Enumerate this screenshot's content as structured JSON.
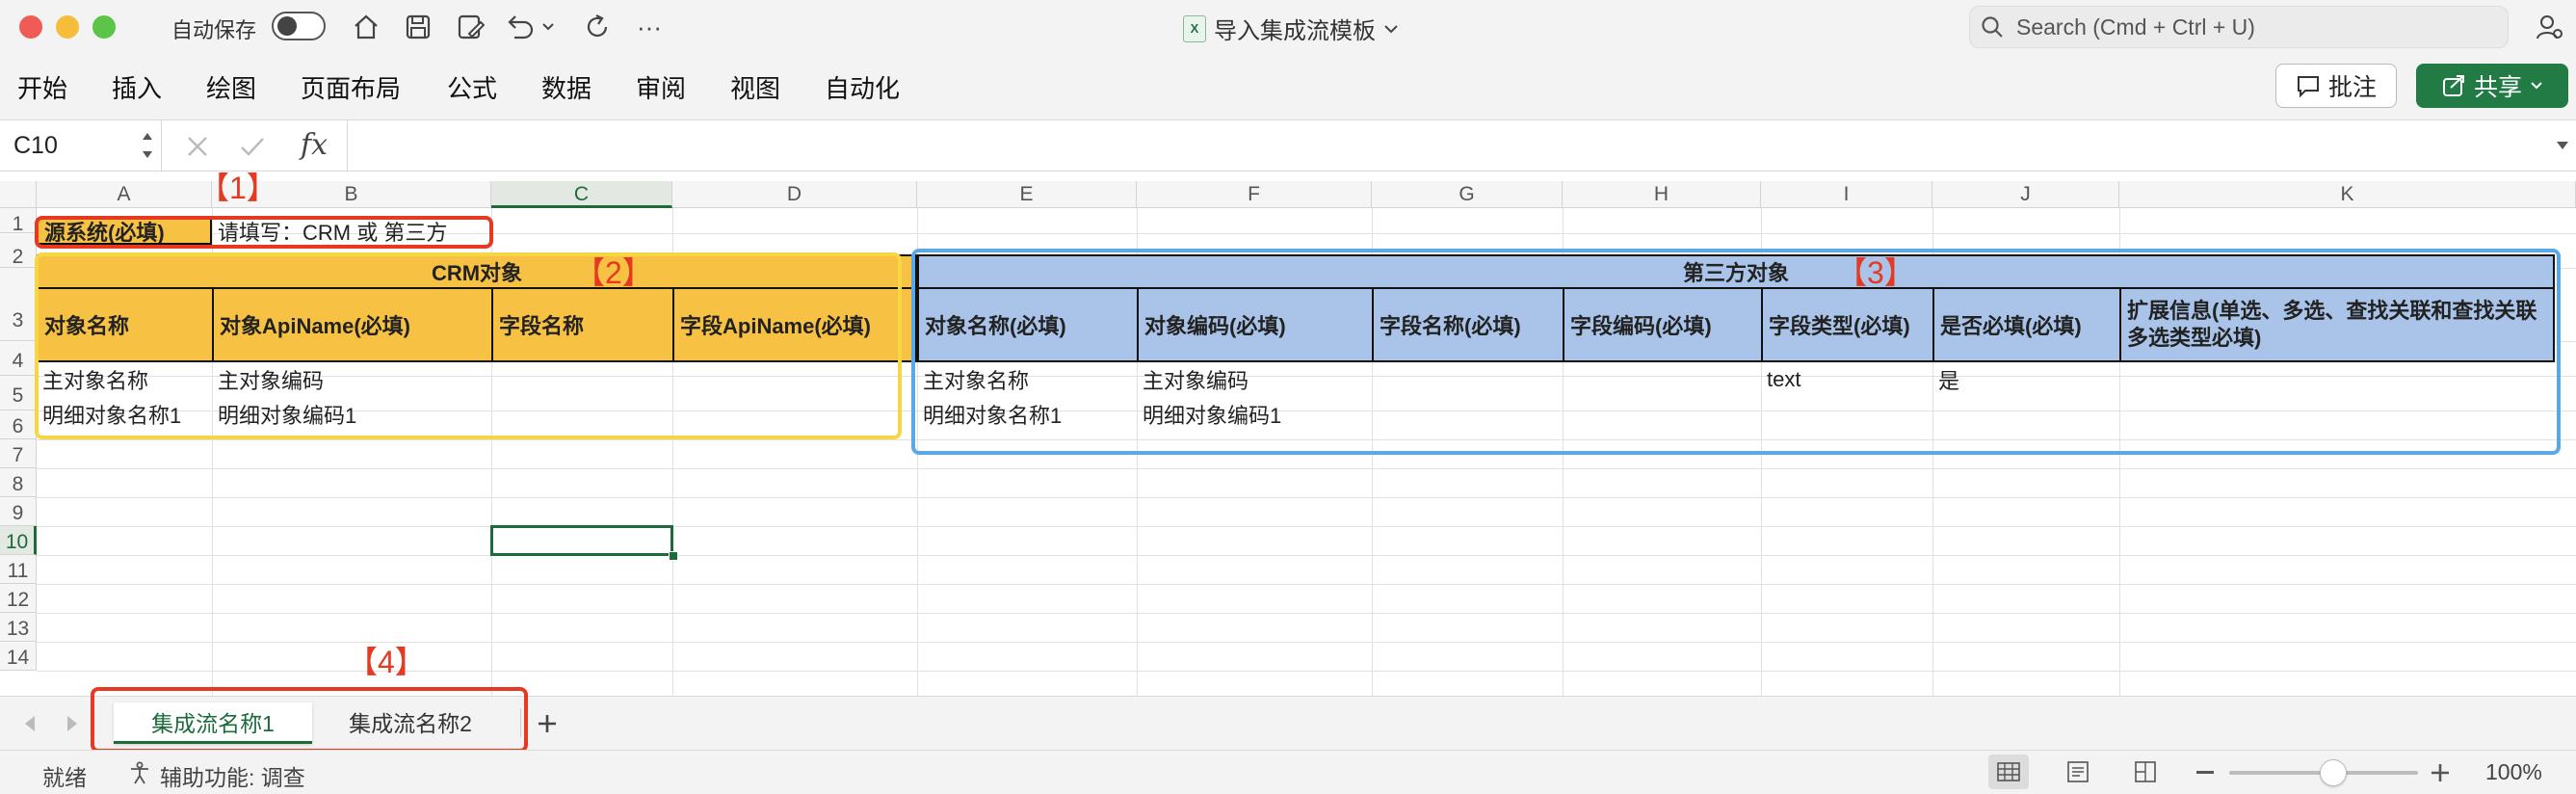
{
  "titlebar": {
    "autosave_label": "自动保存",
    "doc_title": "导入集成流模板",
    "search_placeholder": "Search (Cmd + Ctrl + U)"
  },
  "ribbon": {
    "tabs": [
      "开始",
      "插入",
      "绘图",
      "页面布局",
      "公式",
      "数据",
      "审阅",
      "视图",
      "自动化"
    ],
    "comment_label": "批注",
    "share_label": "共享"
  },
  "formula_bar": {
    "name_box": "C10",
    "fx_label": "fx",
    "formula": ""
  },
  "columns": [
    "A",
    "B",
    "C",
    "D",
    "E",
    "F",
    "G",
    "H",
    "I",
    "J",
    "K"
  ],
  "rows": [
    "1",
    "2",
    "3",
    "4",
    "5",
    "6",
    "7",
    "8",
    "9",
    "10",
    "11",
    "12",
    "13",
    "14"
  ],
  "cells": {
    "A1": "源系统(必填)",
    "B1": "请填写：CRM 或 第三方",
    "crm_title": "CRM对象",
    "third_title": "第三方对象",
    "A3": "对象名称",
    "B3": "对象ApiName(必填)",
    "C3": "字段名称",
    "D3": "字段ApiName(必填)",
    "E3": "对象名称(必填)",
    "F3": "对象编码(必填)",
    "G3": "字段名称(必填)",
    "H3": "字段编码(必填)",
    "I3": "字段类型(必填)",
    "J3": "是否必填(必填)",
    "K3": "扩展信息(单选、多选、查找关联和查找关联多选类型必填)",
    "A4": "主对象名称",
    "B4": "主对象编码",
    "E4": "主对象名称",
    "F4": "主对象编码",
    "I4": "text",
    "J4": "是",
    "A5": "明细对象名称1",
    "B5": "明细对象编码1",
    "E5": "明细对象名称1",
    "F5": "明细对象编码1"
  },
  "annotations": [
    "【1】",
    "【2】",
    "【3】",
    "【4】"
  ],
  "sheets": [
    {
      "name": "集成流名称1",
      "active": true
    },
    {
      "name": "集成流名称2",
      "active": false
    }
  ],
  "status": {
    "ready": "就绪",
    "accessibility": "辅助功能: 调查",
    "zoom": "100%",
    "zoom_fraction": 0.55
  },
  "colors": {
    "crm_fill": "#f7c243",
    "third_fill": "#a9c4e8",
    "annotation_red": "#e53922",
    "box_yellow": "#f6d645",
    "box_blue": "#5aa9e6",
    "excel_green": "#1c6b3b"
  }
}
